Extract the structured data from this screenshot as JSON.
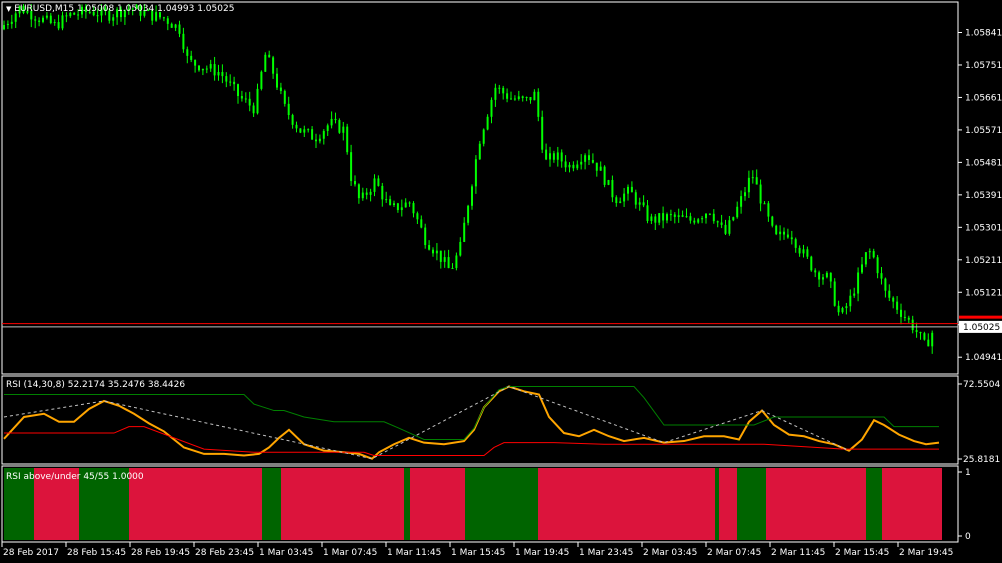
{
  "header": {
    "symbol_line": "EURUSD,M15  1.05008 1.05034 1.04993 1.05025",
    "rsi_line": "RSI (14,30,8) 52.2174 35.2476 38.4426",
    "signal_line": "RSI above/under 45/55 1.0000"
  },
  "colors": {
    "background": "#000000",
    "candles": "#00ff00",
    "price_line": "#c0c0c0",
    "ask_line": "#ff0000",
    "rsi_line": "#ffa500",
    "upper_band": "#008000",
    "lower_band": "#ff0000",
    "above": "#006400",
    "under": "#dc143c"
  },
  "price_axis": {
    "ticks": [
      "1.05841",
      "1.05751",
      "1.05661",
      "1.05571",
      "1.05481",
      "1.05391",
      "1.05301",
      "1.05211",
      "1.05121",
      "1.05031",
      "1.04941"
    ],
    "current_price": "1.05025"
  },
  "rsi_axis": {
    "ticks": [
      "72.5504",
      "25.8181"
    ]
  },
  "signal_axis": {
    "ticks": [
      "1",
      "0"
    ]
  },
  "time_axis": {
    "ticks": [
      "28 Feb 2017",
      "28 Feb 15:45",
      "28 Feb 19:45",
      "28 Feb 23:45",
      "1 Mar 03:45",
      "1 Mar 07:45",
      "1 Mar 11:45",
      "1 Mar 15:45",
      "1 Mar 19:45",
      "1 Mar 23:45",
      "2 Mar 03:45",
      "2 Mar 07:45",
      "2 Mar 11:45",
      "2 Mar 15:45",
      "2 Mar 19:45"
    ]
  },
  "chart_data": [
    {
      "type": "candlestick",
      "title": "EURUSD,M15",
      "ylim": [
        1.049,
        1.0592
      ],
      "current_price": 1.05025,
      "ask_price": 1.05034,
      "close_path": [
        [
          0,
          1.0585
        ],
        [
          10,
          1.0588
        ],
        [
          20,
          1.0591
        ],
        [
          40,
          1.0588
        ],
        [
          55,
          1.0586
        ],
        [
          70,
          1.0589
        ],
        [
          90,
          1.059
        ],
        [
          110,
          1.0589
        ],
        [
          130,
          1.0591
        ],
        [
          150,
          1.0589
        ],
        [
          165,
          1.0588
        ],
        [
          180,
          1.0585
        ],
        [
          188,
          1.0576
        ],
        [
          200,
          1.0575
        ],
        [
          220,
          1.0573
        ],
        [
          240,
          1.0566
        ],
        [
          255,
          1.0563
        ],
        [
          265,
          1.0578
        ],
        [
          272,
          1.0574
        ],
        [
          285,
          1.0563
        ],
        [
          300,
          1.0557
        ],
        [
          315,
          1.0555
        ],
        [
          330,
          1.0559
        ],
        [
          345,
          1.0557
        ],
        [
          350,
          1.0545
        ],
        [
          360,
          1.0537
        ],
        [
          375,
          1.0543
        ],
        [
          390,
          1.0535
        ],
        [
          410,
          1.0537
        ],
        [
          425,
          1.0527
        ],
        [
          440,
          1.0522
        ],
        [
          450,
          1.0518
        ],
        [
          460,
          1.0524
        ],
        [
          470,
          1.054
        ],
        [
          480,
          1.0555
        ],
        [
          495,
          1.0569
        ],
        [
          510,
          1.0566
        ],
        [
          525,
          1.0565
        ],
        [
          535,
          1.0567
        ],
        [
          545,
          1.0548
        ],
        [
          555,
          1.055
        ],
        [
          570,
          1.0547
        ],
        [
          585,
          1.0551
        ],
        [
          600,
          1.0546
        ],
        [
          615,
          1.0538
        ],
        [
          630,
          1.054
        ],
        [
          650,
          1.0532
        ],
        [
          670,
          1.0533
        ],
        [
          690,
          1.0532
        ],
        [
          710,
          1.0535
        ],
        [
          725,
          1.0528
        ],
        [
          740,
          1.0537
        ],
        [
          752,
          1.0545
        ],
        [
          762,
          1.0537
        ],
        [
          775,
          1.0527
        ],
        [
          790,
          1.0529
        ],
        [
          800,
          1.0524
        ],
        [
          815,
          1.0518
        ],
        [
          828,
          1.0516
        ],
        [
          840,
          1.0505
        ],
        [
          850,
          1.051
        ],
        [
          858,
          1.0516
        ],
        [
          868,
          1.0524
        ],
        [
          875,
          1.0521
        ],
        [
          885,
          1.0512
        ],
        [
          900,
          1.0507
        ],
        [
          915,
          1.0502
        ],
        [
          925,
          1.0497
        ],
        [
          935,
          1.05025
        ]
      ]
    },
    {
      "type": "line",
      "title": "RSI (14,30,8)",
      "ylim": [
        25.8181,
        72.5504
      ],
      "series": [
        {
          "name": "RSI",
          "points": [
            [
              0,
              38.4
            ],
            [
              20,
              52
            ],
            [
              40,
              54
            ],
            [
              55,
              49
            ],
            [
              70,
              49
            ],
            [
              85,
              57
            ],
            [
              100,
              62
            ],
            [
              115,
              59
            ],
            [
              130,
              54
            ],
            [
              145,
              48
            ],
            [
              160,
              43
            ],
            [
              180,
              33
            ],
            [
              200,
              29
            ],
            [
              220,
              29
            ],
            [
              240,
              28
            ],
            [
              255,
              29
            ],
            [
              265,
              33
            ],
            [
              275,
              39
            ],
            [
              285,
              44
            ],
            [
              300,
              35
            ],
            [
              320,
              31
            ],
            [
              340,
              30
            ],
            [
              355,
              29
            ],
            [
              368,
              26
            ],
            [
              375,
              30
            ],
            [
              390,
              35
            ],
            [
              405,
              39
            ],
            [
              420,
              36
            ],
            [
              440,
              35
            ],
            [
              460,
              37
            ],
            [
              470,
              44
            ],
            [
              480,
              58
            ],
            [
              495,
              68
            ],
            [
              505,
              71
            ],
            [
              520,
              68
            ],
            [
              535,
              66
            ],
            [
              545,
              52
            ],
            [
              560,
              42
            ],
            [
              575,
              40
            ],
            [
              590,
              44
            ],
            [
              605,
              40
            ],
            [
              620,
              37
            ],
            [
              640,
              39
            ],
            [
              660,
              36
            ],
            [
              680,
              37
            ],
            [
              700,
              40
            ],
            [
              720,
              40
            ],
            [
              735,
              38
            ],
            [
              745,
              49
            ],
            [
              758,
              56
            ],
            [
              770,
              47
            ],
            [
              785,
              41
            ],
            [
              800,
              40
            ],
            [
              815,
              37
            ],
            [
              830,
              35
            ],
            [
              845,
              31
            ],
            [
              858,
              38
            ],
            [
              870,
              50
            ],
            [
              880,
              47
            ],
            [
              895,
              41
            ],
            [
              910,
              37
            ],
            [
              922,
              35
            ],
            [
              935,
              36
            ]
          ]
        },
        {
          "name": "Upper",
          "points": [
            [
              0,
              66
            ],
            [
              100,
              66
            ],
            [
              200,
              66
            ],
            [
              240,
              66
            ],
            [
              250,
              60
            ],
            [
              270,
              56
            ],
            [
              280,
              56
            ],
            [
              300,
              52
            ],
            [
              330,
              49
            ],
            [
              380,
              49
            ],
            [
              395,
              45
            ],
            [
              420,
              38
            ],
            [
              460,
              38
            ],
            [
              470,
              45
            ],
            [
              480,
              58
            ],
            [
              495,
              69
            ],
            [
              505,
              71
            ],
            [
              630,
              71
            ],
            [
              640,
              64
            ],
            [
              660,
              47
            ],
            [
              750,
              47
            ],
            [
              770,
              52
            ],
            [
              880,
              52
            ],
            [
              890,
              46
            ],
            [
              935,
              46
            ]
          ]
        },
        {
          "name": "Lower",
          "points": [
            [
              0,
              42
            ],
            [
              110,
              42
            ],
            [
              125,
              46
            ],
            [
              140,
              46
            ],
            [
              200,
              32
            ],
            [
              250,
              30
            ],
            [
              270,
              30
            ],
            [
              300,
              30
            ],
            [
              360,
              30
            ],
            [
              370,
              28
            ],
            [
              480,
              28
            ],
            [
              490,
              33
            ],
            [
              500,
              36
            ],
            [
              550,
              36
            ],
            [
              600,
              35
            ],
            [
              680,
              35
            ],
            [
              740,
              35
            ],
            [
              760,
              35
            ],
            [
              840,
              32
            ],
            [
              935,
              32
            ]
          ]
        }
      ],
      "grid": false
    },
    {
      "type": "area",
      "title": "RSI above/under 45/55",
      "ylim": [
        0,
        1
      ],
      "segments": [
        [
          0,
          30,
          1
        ],
        [
          30,
          37,
          0
        ],
        [
          37,
          75,
          0
        ],
        [
          75,
          80,
          1
        ],
        [
          80,
          125,
          1
        ],
        [
          125,
          258,
          0
        ],
        [
          258,
          265,
          1
        ],
        [
          265,
          277,
          1
        ],
        [
          277,
          400,
          0
        ],
        [
          400,
          406,
          1
        ],
        [
          406,
          461,
          0
        ],
        [
          461,
          534,
          1
        ],
        [
          534,
          711,
          0
        ],
        [
          711,
          715,
          1
        ],
        [
          715,
          733,
          0
        ],
        [
          733,
          762,
          1
        ],
        [
          762,
          862,
          0
        ],
        [
          862,
          878,
          1
        ],
        [
          878,
          938,
          0
        ]
      ],
      "current_value": 1.0
    }
  ]
}
